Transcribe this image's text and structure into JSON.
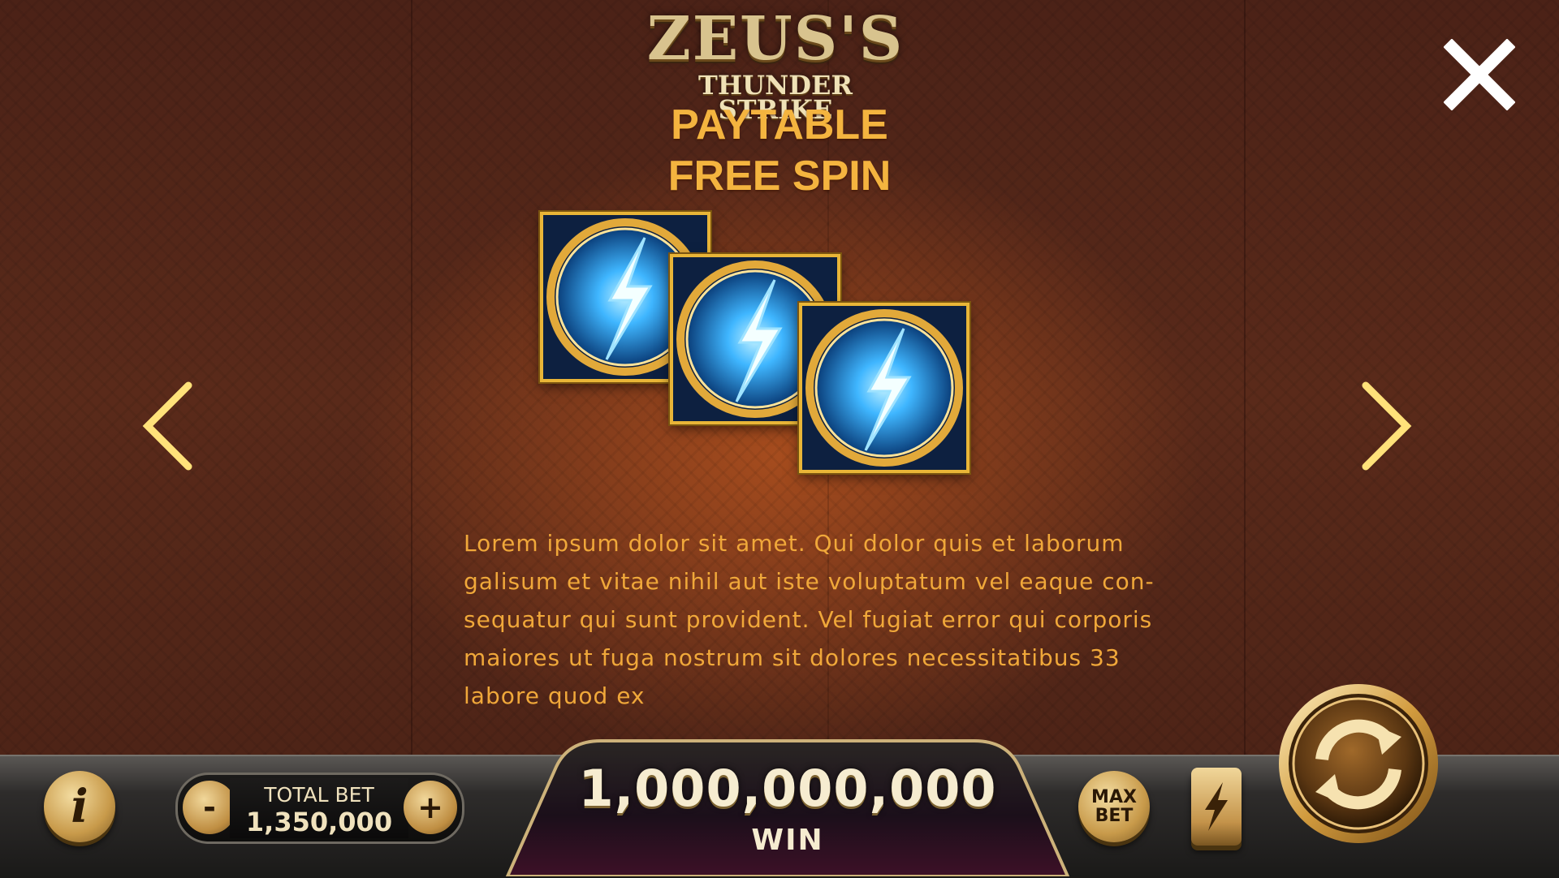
{
  "logo": {
    "title": "ZEUS'S",
    "subtitle": "THUNDER STRIKE"
  },
  "page": {
    "section_title": "PAYTABLE",
    "symbol_title": "FREE SPIN"
  },
  "symbols": [
    {
      "name": "lightning-orb-scatter"
    },
    {
      "name": "lightning-orb-scatter"
    },
    {
      "name": "lightning-orb-scatter"
    }
  ],
  "description": {
    "lines": [
      "Lorem ipsum dolor sit amet. Qui dolor quis et laborum",
      "galisum et vitae nihil aut iste voluptatum vel eaque con-",
      "sequatur qui sunt provident. Vel fugiat error qui corporis",
      "maiores ut fuga nostrum sit dolores necessitatibus 33",
      "labore quod ex"
    ]
  },
  "controls": {
    "info_label": "i",
    "bet_label": "TOTAL BET",
    "bet_value": "1,350,000",
    "minus_label": "-",
    "plus_label": "+",
    "win_amount": "1,000,000,000",
    "win_label": "WIN",
    "max_bet_label": "MAX\nBET"
  },
  "icons": {
    "close": "close-icon",
    "prev": "chevron-left-icon",
    "next": "chevron-right-icon",
    "turbo": "lightning-icon",
    "spin": "refresh-icon"
  },
  "colors": {
    "title_gold": "#f4b43f",
    "text_orange": "#f0a83a",
    "arrow_yellow": "#ffe27a",
    "gold_button": "#c89a4a",
    "orb_blue": "#3fb6ff"
  }
}
